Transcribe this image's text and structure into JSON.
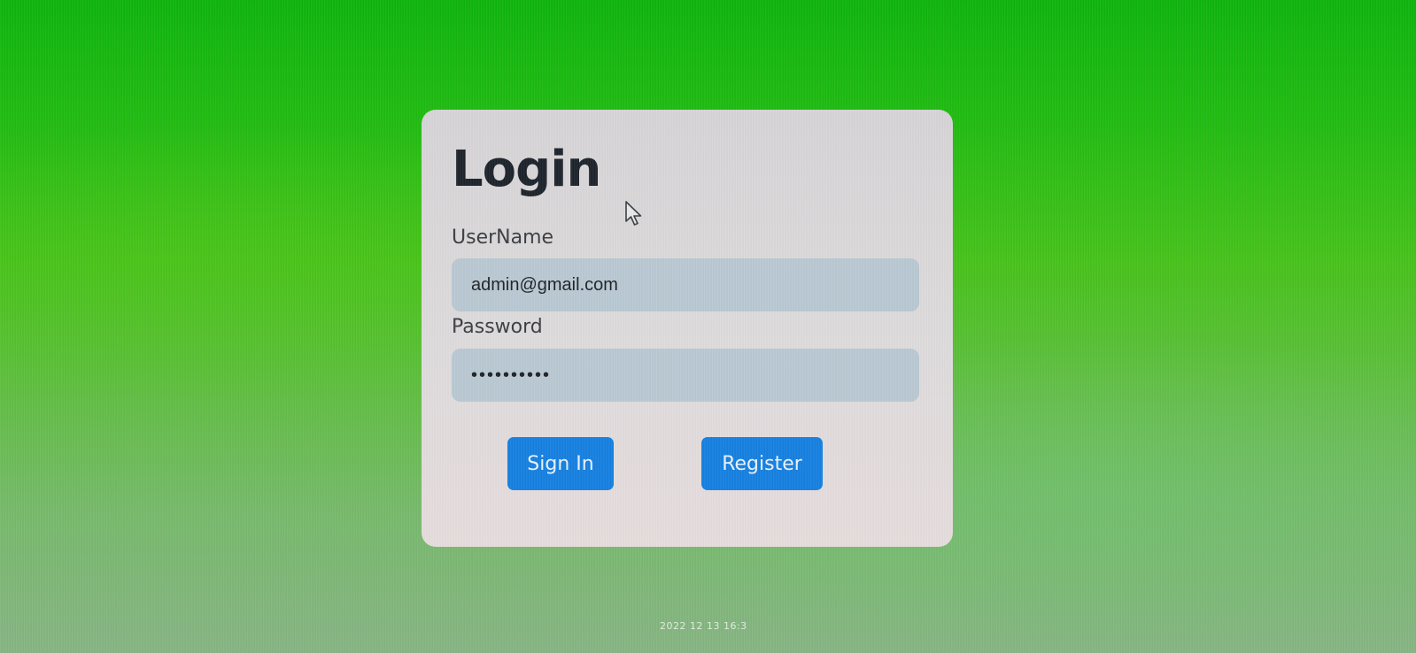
{
  "login_card": {
    "title": "Login",
    "username_label": "UserName",
    "username_value": "admin@gmail.com",
    "password_label": "Password",
    "password_value": "••••••••••",
    "sign_in_label": "Sign In",
    "register_label": "Register"
  },
  "colors": {
    "background_top": "#0db40c",
    "background_bottom": "#86b483",
    "card": "#dcdadb",
    "input": "#b9c8d2",
    "button": "#1580e0",
    "title_text": "#1d232b"
  },
  "icons": {
    "cursor": "mouse-pointer-icon"
  },
  "photo_timestamp": "2022 12 13 16:3"
}
